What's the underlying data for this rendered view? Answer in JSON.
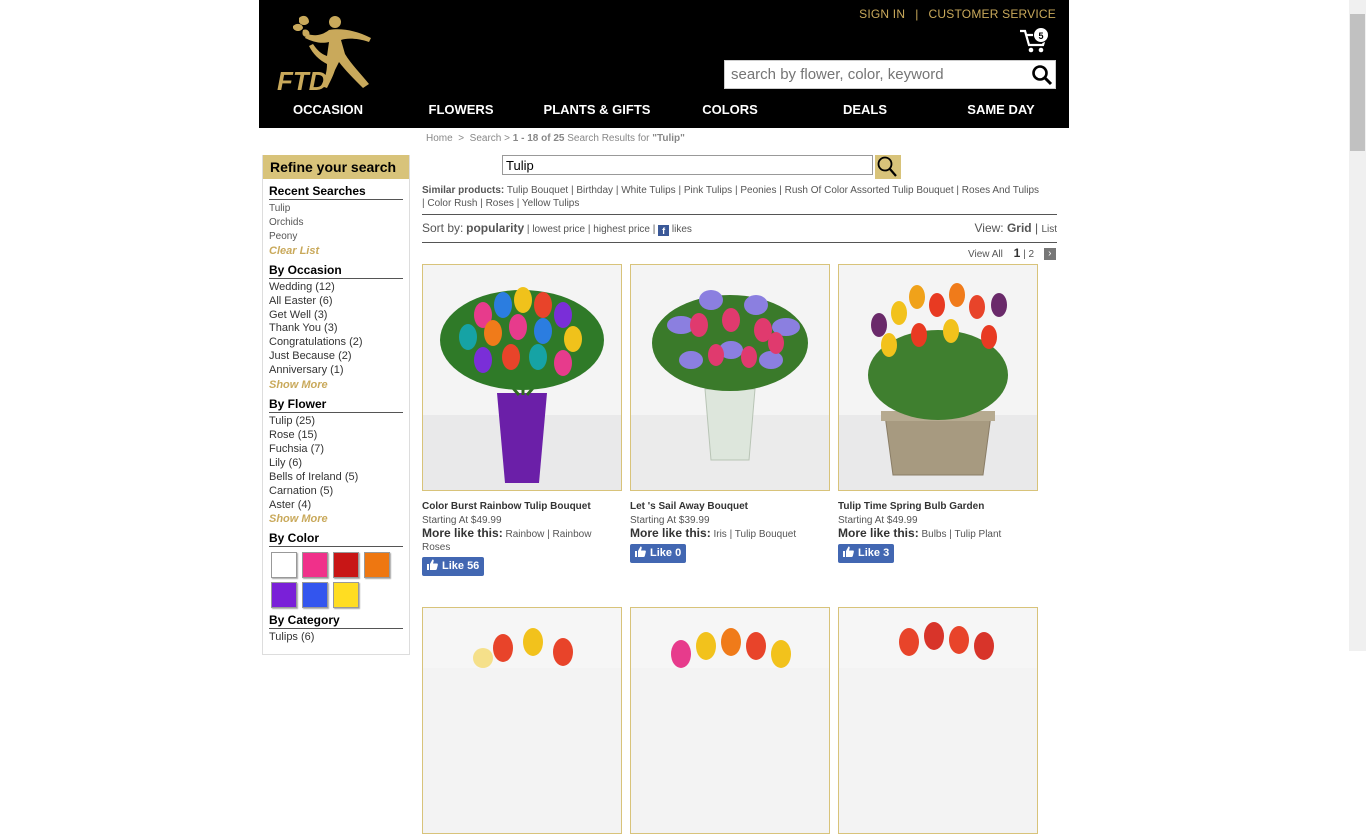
{
  "header": {
    "logo_text": "FTD",
    "sign_in": "SIGN IN",
    "separator": "|",
    "customer_service": "CUSTOMER SERVICE",
    "cart_count": "5",
    "search_placeholder": "search by flower, color, keyword"
  },
  "nav": [
    "OCCASION",
    "FLOWERS",
    "PLANTS & GIFTS",
    "COLORS",
    "DEALS",
    "SAME DAY"
  ],
  "breadcrumb": {
    "home": "Home",
    "sep": ">",
    "search": "Search",
    "results": "1 - 18 of 25",
    "results_suffix": "Search Results for",
    "query": "\"Tulip\""
  },
  "sidebar": {
    "refine_title": "Refine your search",
    "recent_title": "Recent Searches",
    "recent": [
      "Tulip",
      "Orchids",
      "Peony"
    ],
    "clear_list": "Clear List",
    "occasion_title": "By Occasion",
    "occasion": [
      "Wedding (12)",
      "All Easter (6)",
      "Get Well (3)",
      "Thank You (3)",
      "Congratulations (2)",
      "Just Because (2)",
      "Anniversary (1)"
    ],
    "occasion_more": "Show More",
    "flower_title": "By Flower",
    "flower": [
      "Tulip (25)",
      "Rose (15)",
      "Fuchsia (7)",
      "Lily (6)",
      "Bells of Ireland (5)",
      "Carnation (5)",
      "Aster (4)"
    ],
    "flower_more": "Show More",
    "color_title": "By Color",
    "colors": [
      "#ffffff",
      "#f0308a",
      "#c81616",
      "#ee7711",
      "#7a20d8",
      "#3355ee",
      "#ffdd22"
    ],
    "category_title": "By Category",
    "category": [
      "Tulips (6)"
    ]
  },
  "main": {
    "search_value": "Tulip",
    "similar_label": "Similar products:",
    "similar": [
      "Tulip Bouquet",
      "Birthday",
      "White Tulips",
      "Pink Tulips",
      "Peonies",
      "Rush Of Color Assorted Tulip Bouquet",
      "Roses And Tulips",
      "Color Rush",
      "Roses",
      "Yellow Tulips"
    ],
    "sort_label": "Sort by:",
    "sort_popularity": "popularity",
    "sort_lowest": "lowest price",
    "sort_highest": "highest price",
    "sort_likes": "likes",
    "view_label": "View:",
    "view_grid": "Grid",
    "view_list": "List",
    "view_all": "View All",
    "page_current": "1",
    "page_2": "2"
  },
  "products": [
    {
      "name": "Color Burst Rainbow Tulip Bouquet",
      "price": "Starting At $49.99",
      "more_label": "More like this:",
      "more": "Rainbow | Rainbow Roses",
      "likes": "Like 56"
    },
    {
      "name": "Let 's Sail Away Bouquet",
      "price": "Starting At $39.99",
      "more_label": "More like this:",
      "more": "Iris | Tulip Bouquet",
      "likes": "Like 0"
    },
    {
      "name": "Tulip Time Spring Bulb Garden",
      "price": "Starting At $49.99",
      "more_label": "More like this:",
      "more": "Bulbs | Tulip Plant",
      "likes": "Like 3"
    }
  ],
  "colors": {
    "gold": "#c9a95b",
    "header_bg": "#000000",
    "refine_bg": "#d8c37a",
    "fb_blue": "#4267b2"
  }
}
